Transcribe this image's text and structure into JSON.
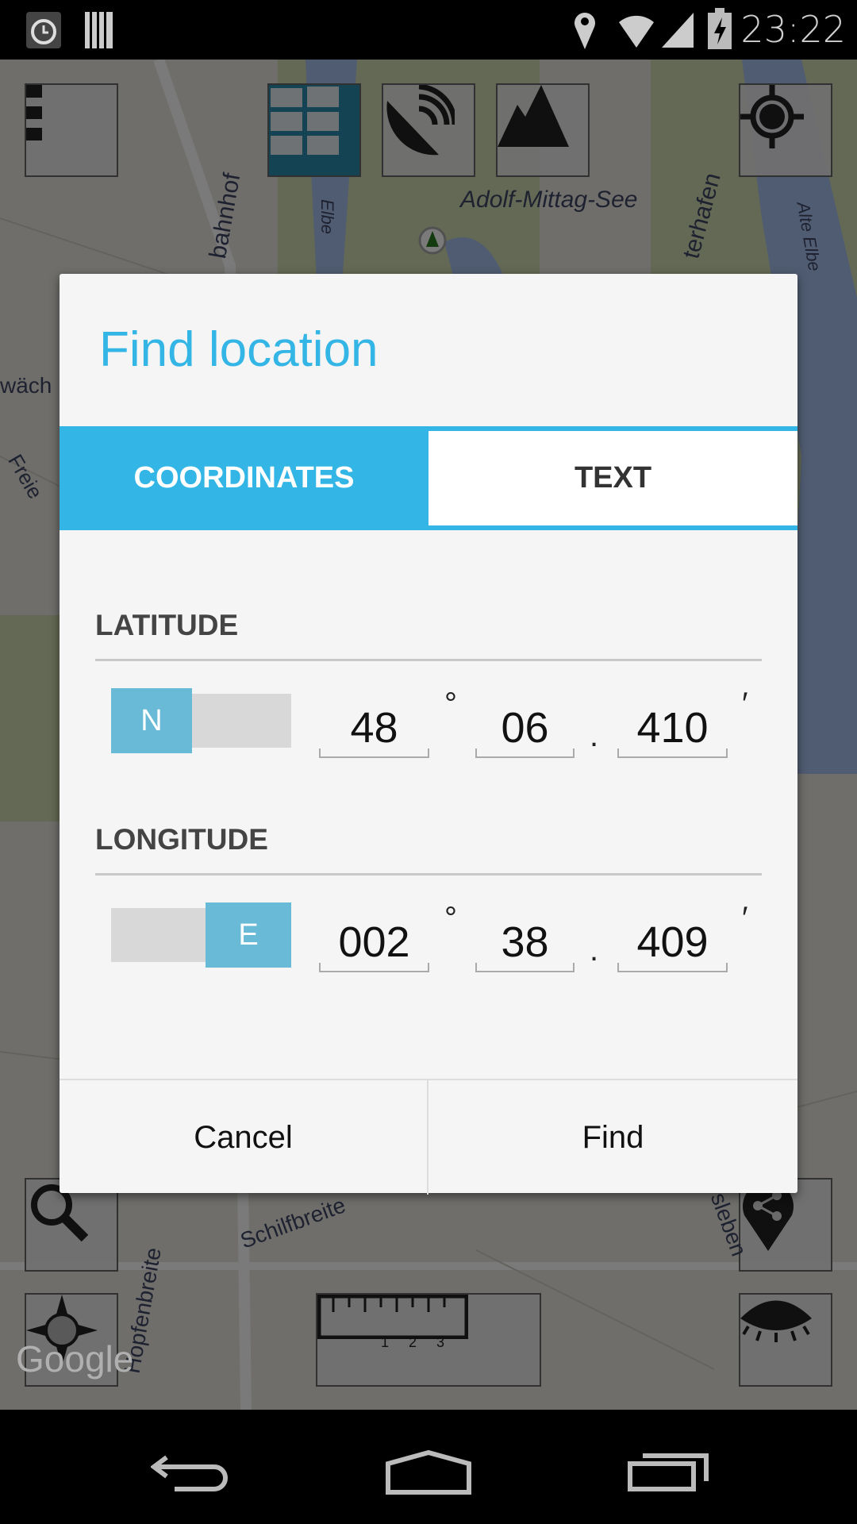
{
  "status_bar": {
    "time": "23:22",
    "icons": [
      "alarm-icon",
      "barcode-icon",
      "location-pin-icon",
      "wifi-icon",
      "signal-icon",
      "battery-charging-icon"
    ]
  },
  "map": {
    "labels": [
      "Adolf-Mittag-See",
      "Elbe",
      "Alte Elbe",
      "bahnhof",
      "terhafen",
      "wäch",
      "Freie",
      "Schilfbreite",
      "Hopfenbreite",
      "ersleben",
      "Google"
    ],
    "top_buttons": [
      "menu-icon",
      "map-type-icon",
      "satellite-icon",
      "terrain-icon",
      "gps-locate-icon"
    ],
    "bottom_buttons": [
      "search-icon",
      "share-location-icon",
      "compass-icon",
      "ruler-icon",
      "eye-icon"
    ],
    "ruler_ticks": [
      "1",
      "2",
      "3"
    ]
  },
  "dialog": {
    "title": "Find location",
    "tabs": [
      {
        "label": "COORDINATES",
        "active": true
      },
      {
        "label": "TEXT",
        "active": false
      }
    ],
    "latitude": {
      "label": "LATITUDE",
      "hemisphere": "N",
      "degrees": "48",
      "minutes": "06",
      "decimal": "410"
    },
    "longitude": {
      "label": "LONGITUDE",
      "hemisphere": "E",
      "degrees": "002",
      "minutes": "38",
      "decimal": "409"
    },
    "symbols": {
      "degree": "°",
      "dot": ".",
      "minute": "′"
    },
    "buttons": {
      "cancel": "Cancel",
      "find": "Find"
    }
  },
  "colors": {
    "accent": "#33b5e5",
    "toggle": "#69bad6"
  }
}
